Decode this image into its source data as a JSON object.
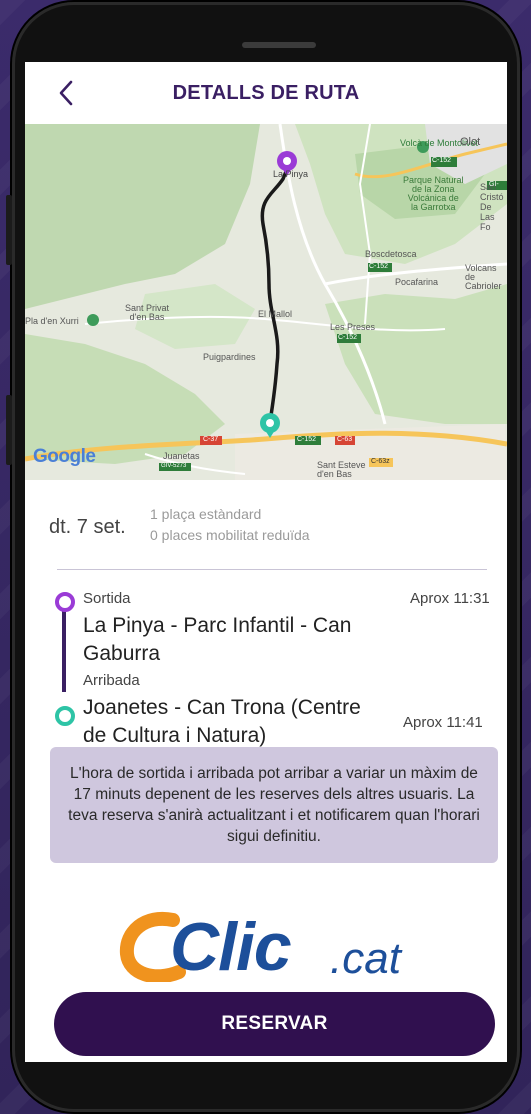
{
  "header": {
    "title": "DETALLS DE RUTA"
  },
  "map": {
    "brand": "Google",
    "labels": {
      "volcano": "Volcà de Montolivet",
      "olot": "Olot",
      "start": "La Pinya",
      "park1": "Parque Natural",
      "park2": "de la Zona",
      "park3": "Volcánica de",
      "park4": "la Garrotxa",
      "cristof1": "San Cristó",
      "cristof2": "De Las Fo",
      "boscdetosca": "Boscdetosca",
      "pocafarina": "Pocafarina",
      "volcans1": "Volcans de",
      "volcans2": "Cabrioler",
      "santprivat1": "Sant Privat",
      "santprivat2": "d'en Bas",
      "pladenxurri": "Pla d'en Xurri",
      "elmallol": "El Mallol",
      "lespreses": "Les Preses",
      "puigpardines": "Puigpardines",
      "juanetas": "Juanetas",
      "santesteve1": "Sant Esteve",
      "santesteve2": "d'en Bas",
      "r_c152": "C-152",
      "r_c37": "C-37",
      "r_c63": "C-63",
      "r_c63z": "C-63z",
      "r_giv": "GIV-5273",
      "r_gi": "GI-"
    }
  },
  "trip": {
    "date": "dt. 7 set.",
    "seats_standard": "1 plaça estàndard",
    "seats_reduced": "0 places mobilitat reduïda",
    "departure_label": "Sortida",
    "departure_stop_line1": "La Pinya - Parc Infantil - Can",
    "departure_stop_line2": "Gaburra",
    "departure_time": "Aprox 11:31",
    "arrival_label": "Arribada",
    "arrival_stop_line1": "Joanetes - Can Trona (Centre",
    "arrival_stop_line2": "de Cultura i Natura)",
    "arrival_time": "Aprox 11:41"
  },
  "notice": {
    "text": "L'hora de sortida i arribada pot arribar a variar un màxim de 17 minuts depenent de les reserves dels altres usuaris. La teva reserva s'anirà actualitzant i et notificarem quan l'horari sigui definitiu."
  },
  "logo": {
    "main": "Clic",
    "suffix": ".cat"
  },
  "actions": {
    "reserve_label": "RESERVAR"
  },
  "colors": {
    "primary": "#30104f",
    "title": "#3a1f63",
    "start_marker": "#9a3bd6",
    "end_marker": "#2ec4a6",
    "notice_bg": "#cfc7de",
    "logo_orange": "#f0931e",
    "logo_blue": "#1d4f9a"
  }
}
